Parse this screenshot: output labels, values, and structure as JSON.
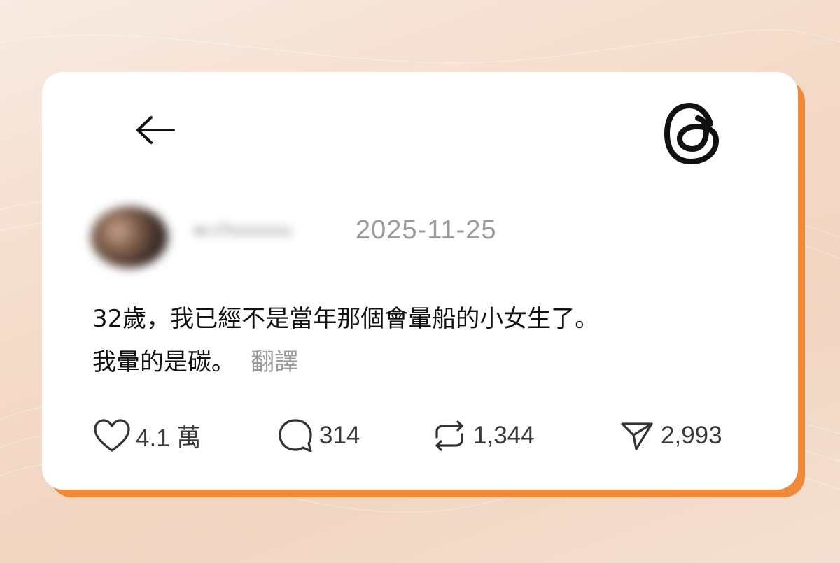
{
  "post": {
    "username": "w.chuuuuu",
    "date": "2025-11-25",
    "text_line1": "32歲，我已經不是當年那個會暈船的小女生了。",
    "text_line2": "我暈的是碳。",
    "translate_label": "翻譯"
  },
  "actions": {
    "likes": "4.1 萬",
    "replies": "314",
    "reposts": "1,344",
    "shares": "2,993"
  },
  "icons": {
    "back": "arrow-left-icon",
    "logo": "threads-logo-icon",
    "like": "heart-icon",
    "reply": "comment-bubble-icon",
    "repost": "repost-icon",
    "share": "send-icon"
  },
  "colors": {
    "accent": "#ef8a3a",
    "card": "#ffffff",
    "muted_text": "#9a9a9a",
    "text": "#111111"
  }
}
